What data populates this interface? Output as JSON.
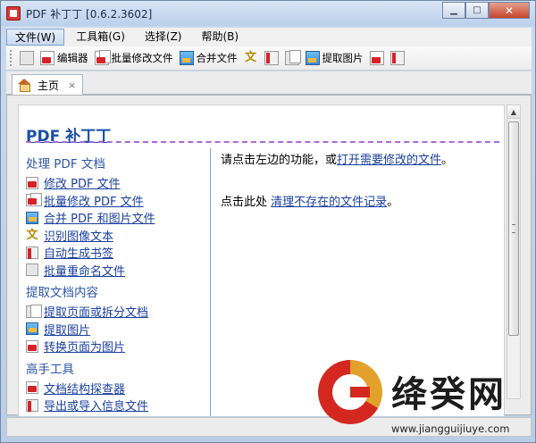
{
  "window": {
    "title": "PDF 补丁丁 [0.6.2.3602]"
  },
  "menu": {
    "items": [
      "文件(W)",
      "工具箱(G)",
      "选择(Z)",
      "帮助(B)"
    ]
  },
  "toolbar": {
    "editor": "编辑器",
    "batch_modify": "批量修改文件",
    "merge": "合并文件",
    "extract_images": "提取图片"
  },
  "tabs": [
    {
      "label": "主页",
      "close": "×"
    }
  ],
  "page": {
    "title": "PDF 补丁丁"
  },
  "sidebar": {
    "sections": [
      {
        "title": "处理 PDF 文档",
        "links": [
          "修改 PDF 文件",
          "批量修改 PDF 文件",
          "合并 PDF 和图片文件",
          "识别图像文本",
          "自动生成书签",
          "批量重命名文件"
        ]
      },
      {
        "title": "提取文档内容",
        "links": [
          "提取页面或拆分文档",
          "提取图片",
          "转换页面为图片"
        ]
      },
      {
        "title": "高手工具",
        "links": [
          "文档结构探查器",
          "导出或导入信息文件"
        ]
      }
    ]
  },
  "main": {
    "line1_prefix": "请点击左边的功能，或",
    "line1_link": "打开需要修改的文件",
    "line1_suffix": "。",
    "line2_prefix": "点击此处 ",
    "line2_link": "清理不存在的文件记录",
    "line2_suffix": "。"
  },
  "watermark": {
    "name": "绛癸网",
    "url": "www.jiangguijiuye.com"
  },
  "colors": {
    "link": "#1a3f9e",
    "section": "#2d55a6",
    "title": "#1a4fa8",
    "divider": "#a96ad3"
  }
}
